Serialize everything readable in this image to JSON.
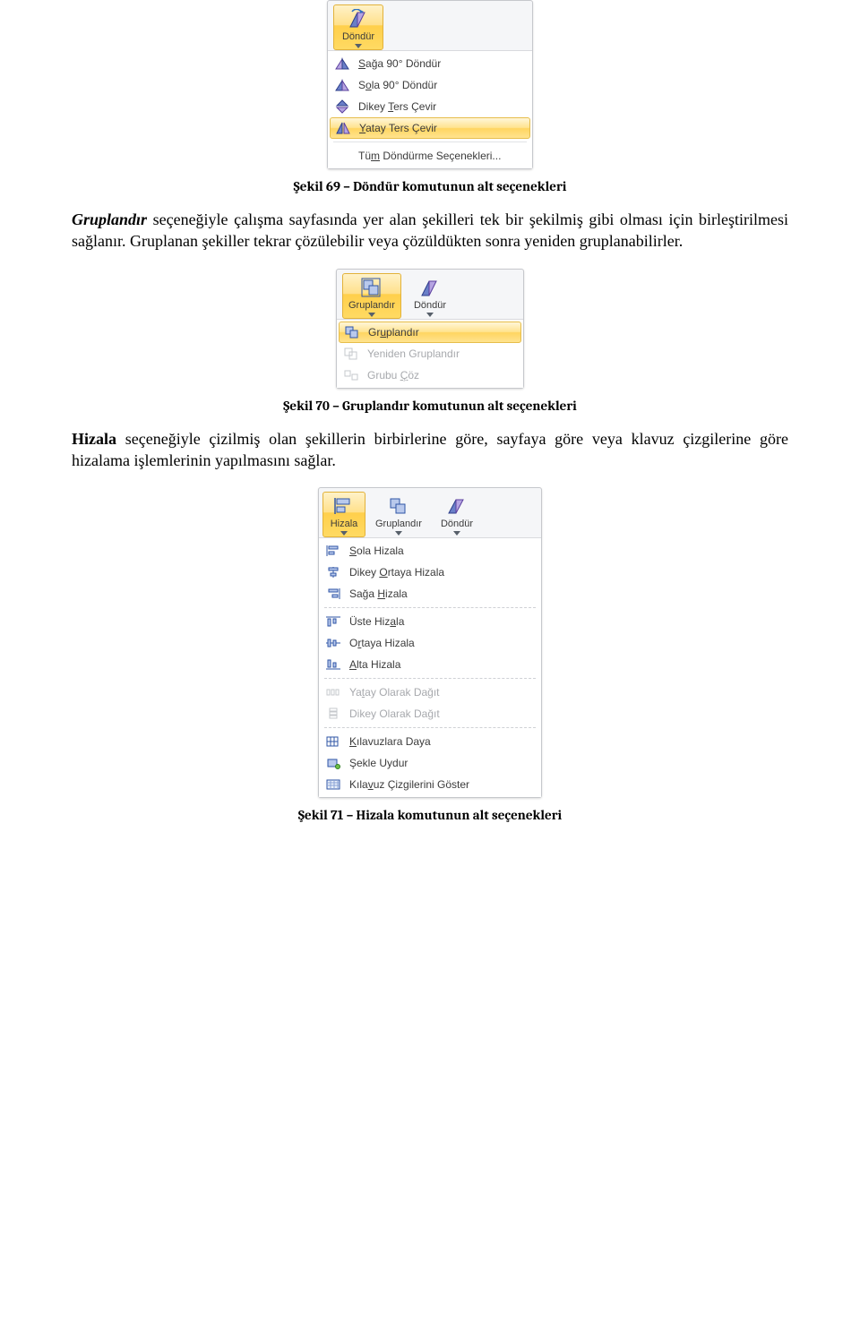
{
  "fig69": {
    "button_label": "Döndür",
    "menu": {
      "rotate_right": "Sağa 90° Döndür",
      "rotate_left": "Sola 90° Döndür",
      "flip_vertical": "Dikey Ters Çevir",
      "flip_horizontal": "Yatay Ters Çevir",
      "more": "Tüm Döndürme Seçenekleri..."
    },
    "caption": "Şekil 69 – Döndür komutunun alt seçenekleri"
  },
  "para1": {
    "lead": "Gruplandır",
    "rest": " seçeneğiyle çalışma sayfasında yer alan şekilleri tek bir şekilmiş gibi olması için birleştirilmesi sağlanır. Gruplanan şekiller tekrar çözülebilir veya çözüldükten sonra yeniden gruplanabilirler."
  },
  "fig70": {
    "btn_group": "Gruplandır",
    "btn_rotate": "Döndür",
    "menu": {
      "group": "Gruplandır",
      "regroup": "Yeniden Gruplandır",
      "ungroup": "Grubu Çöz"
    },
    "caption": "Şekil 70 – Gruplandır komutunun alt seçenekleri"
  },
  "para2": {
    "lead": "Hizala",
    "rest": " seçeneğiyle çizilmiş olan şekillerin birbirlerine göre, sayfaya göre veya klavuz çizgilerine göre hizalama işlemlerinin yapılmasını sağlar."
  },
  "fig71": {
    "btn_align": "Hizala",
    "btn_group": "Gruplandır",
    "btn_rotate": "Döndür",
    "menu": {
      "left": "Sola Hizala",
      "center_v": "Dikey Ortaya Hizala",
      "right": "Sağa Hizala",
      "top": "Üste Hizala",
      "middle": "Ortaya Hizala",
      "bottom": "Alta Hizala",
      "dist_h": "Yatay Olarak Dağıt",
      "dist_v": "Dikey Olarak Dağıt",
      "snap_grid": "Kılavuzlara Daya",
      "snap_shape": "Şekle Uydur",
      "show_grid": "Kılavuz Çizgilerini Göster"
    },
    "caption": "Şekil 71 – Hizala komutunun alt seçenekleri"
  }
}
